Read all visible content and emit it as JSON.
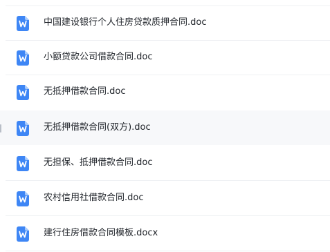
{
  "file_list": {
    "hovered_index": 3,
    "items": [
      {
        "name": "中国建设银行个人住房贷款质押合同.doc",
        "icon": "word-doc-icon"
      },
      {
        "name": "小额贷款公司借款合同.doc",
        "icon": "word-doc-icon"
      },
      {
        "name": "无抵押借款合同.doc",
        "icon": "word-doc-icon"
      },
      {
        "name": "无抵押借款合同(双方).doc",
        "icon": "word-doc-icon"
      },
      {
        "name": "无担保、抵押借款合同.doc",
        "icon": "word-doc-icon"
      },
      {
        "name": "农村信用社借款合同.doc",
        "icon": "word-doc-icon"
      },
      {
        "name": "建行住房借款合同模板.docx",
        "icon": "word-doc-icon"
      }
    ],
    "colors": {
      "icon_blue": "#3e86f5",
      "icon_fold": "#a9cbfb",
      "text": "#1f2329",
      "hover_bg": "#f7f8fa",
      "divider": "#eef0f3"
    }
  }
}
